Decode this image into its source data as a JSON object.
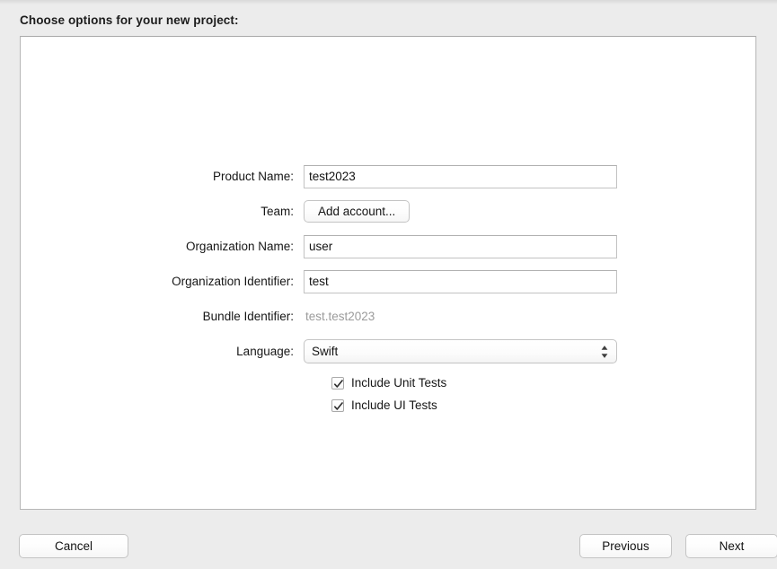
{
  "window": {
    "prompt": "Choose options for your new project:"
  },
  "form": {
    "rows": [
      {
        "label": "Product Name:",
        "value": "test2023",
        "type": "text"
      },
      {
        "label": "Team:",
        "value": "Add account...",
        "type": "button"
      },
      {
        "label": "Organization Name:",
        "value": "user",
        "type": "text"
      },
      {
        "label": "Organization Identifier:",
        "value": "test",
        "type": "text"
      },
      {
        "label": "Bundle Identifier:",
        "value": "test.test2023",
        "type": "static"
      },
      {
        "label": "Language:",
        "value": "Swift",
        "type": "select"
      }
    ],
    "checkboxes": [
      {
        "label": "Include Unit Tests",
        "checked": true
      },
      {
        "label": "Include UI Tests",
        "checked": true
      }
    ]
  },
  "footer": {
    "cancel_label": "Cancel",
    "previous_label": "Previous",
    "next_label": "Next"
  },
  "icons": {
    "stepper": "chevron-up-down-icon",
    "check": "checkmark-icon"
  },
  "colors": {
    "page_background": "#ececec",
    "panel_background": "#ffffff",
    "panel_border": "#b6b6b6",
    "field_border": "#c2c2c2",
    "text": "#161616",
    "disabled_text": "#9b9b9b"
  }
}
